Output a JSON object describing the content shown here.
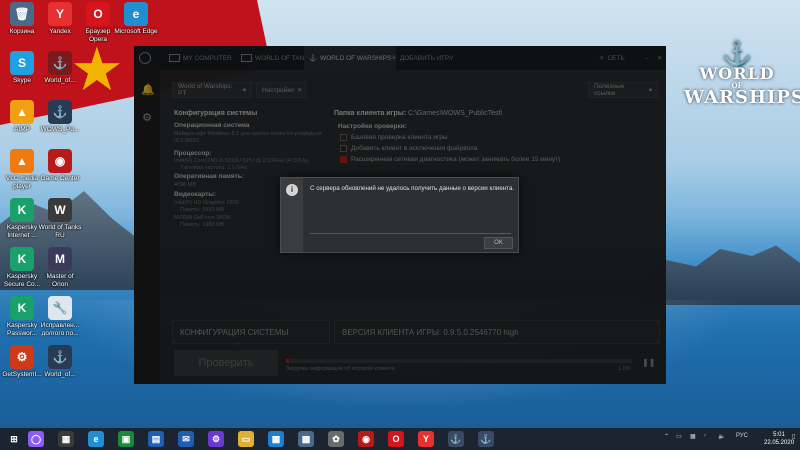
{
  "desktop": {
    "icons": [
      {
        "label": "Корзина",
        "glyph": "🗑",
        "color": "#4a6a8a"
      },
      {
        "label": "Yandex",
        "glyph": "Y",
        "color": "#e83030"
      },
      {
        "label": "Браузер Opera",
        "glyph": "O",
        "color": "#d4161c"
      },
      {
        "label": "Microsoft Edge",
        "glyph": "e",
        "color": "#1f8fd0"
      },
      {
        "label": "Skype",
        "glyph": "S",
        "color": "#1fa0e0"
      },
      {
        "label": "World_of...",
        "glyph": "⚓",
        "color": "#7a1a1a"
      },
      {
        "label": "AIMP",
        "glyph": "▲",
        "color": "#f0a010"
      },
      {
        "label": "WOWS_Pu...",
        "glyph": "⚓",
        "color": "#2a3a55"
      },
      {
        "label": "VLC media player",
        "glyph": "▲",
        "color": "#f07a10"
      },
      {
        "label": "Game Center",
        "glyph": "◉",
        "color": "#b81a1a"
      },
      {
        "label": "Kaspersky Internet ...",
        "glyph": "K",
        "color": "#1aa06a"
      },
      {
        "label": "World of Tanks RU",
        "glyph": "W",
        "color": "#3a3a3a"
      },
      {
        "label": "Kaspersky Secure Co...",
        "glyph": "K",
        "color": "#1aa06a"
      },
      {
        "label": "Master of Orion",
        "glyph": "M",
        "color": "#3a3a5a"
      },
      {
        "label": "Kaspersky Passwor...",
        "glyph": "K",
        "color": "#1aa06a"
      },
      {
        "label": "Исправлен... долгого по...",
        "glyph": "🔧",
        "color": "#dfe6ee"
      },
      {
        "label": "GetSystemI...",
        "glyph": "⚙",
        "color": "#cc3a1a"
      },
      {
        "label": "World_of...",
        "glyph": "⚓",
        "color": "#2a3a55"
      }
    ]
  },
  "brand": {
    "line1": "WORLD",
    "line2": "OF",
    "line3": "WARSHIPS"
  },
  "launcher": {
    "tabs": {
      "my_computer": "MY COMPUTER",
      "world_of_tanks": "WORLD OF TANKS",
      "world_of_warships": "WORLD OF WARSHIPS",
      "add_game": "ДОБАВИТЬ ИГРУ"
    },
    "network_label": "СЕТЬ",
    "game_select": "World of Warships: PT",
    "settings_label": "Настройки",
    "links_select": "Полезные ссылки",
    "sys_config_title": "Конфигурация системы",
    "os_title": "Операционная система",
    "os_value": "Майкрософт Windows 8.1 для одного языка 64-разрядная (6.3.9600)",
    "cpu_title": "Процессор:",
    "cpu_value": "Intel(R) Core(TM) i3-5010U CPU @ 2.10GHz (4 CPUs)",
    "cpu_freq": "Тактовая частота: 2.1 GHz",
    "ram_title": "Оперативная память:",
    "ram_value": "4096 MB",
    "gpu_title": "Видеокарты:",
    "gpu1": "Intel(R) HD Graphics 5500",
    "gpu1_mem": "Память: 1983 MB",
    "gpu2": "NVIDIA GeForce 940M",
    "gpu2_mem": "Память: 1983 MB",
    "client_folder_label": "Папка клиента игры:",
    "client_folder_value": "C:\\Games\\WOWS_PublicTest\\",
    "check_settings_title": "Настройки проверки:",
    "check_basic": "Базовая проверка клиента игры",
    "check_firewall": "Добавить клиент в исключения файрвола",
    "check_network": "Расширенная сетевая диагностика (может занимать более 15 минут)",
    "panel_sysconfig": "КОНФИГУРАЦИЯ СИСТЕМЫ",
    "panel_version": "ВЕРСИЯ КЛИЕНТА ИГРЫ: 0.9.5.0.2546770 high",
    "play_button": "Проверить",
    "progress_label": "Загрузка информации об игровом клиенте",
    "progress_percent": "1.0%",
    "progress_value": 0.01
  },
  "dialog": {
    "message": "С сервера обновлений не удалось получить данные о версии клиента.",
    "ok_button": "OK"
  },
  "taskbar": {
    "apps": [
      {
        "glyph": "◯",
        "color": "#8b5cf6"
      },
      {
        "glyph": "▦",
        "color": "#3a3a3a"
      },
      {
        "glyph": "e",
        "color": "#1f8fd0"
      },
      {
        "glyph": "▣",
        "color": "#1a8a3a"
      },
      {
        "glyph": "▤",
        "color": "#1e5fb3"
      },
      {
        "glyph": "✉",
        "color": "#1e5fb3"
      },
      {
        "glyph": "⚙",
        "color": "#6a3ad0"
      },
      {
        "glyph": "▭",
        "color": "#e0b030"
      },
      {
        "glyph": "▦",
        "color": "#1e7fd0"
      },
      {
        "glyph": "▩",
        "color": "#4a6a8a"
      },
      {
        "glyph": "✿",
        "color": "#6a6a6a"
      },
      {
        "glyph": "◉",
        "color": "#b81a1a"
      },
      {
        "glyph": "O",
        "color": "#d4161c"
      },
      {
        "glyph": "Y",
        "color": "#e83030"
      },
      {
        "glyph": "⚓",
        "color": "#3a4a66"
      },
      {
        "glyph": "⚓",
        "color": "#3a4a66"
      }
    ],
    "lang": "РУС",
    "time": "5:01",
    "date": "22.05.2020"
  }
}
